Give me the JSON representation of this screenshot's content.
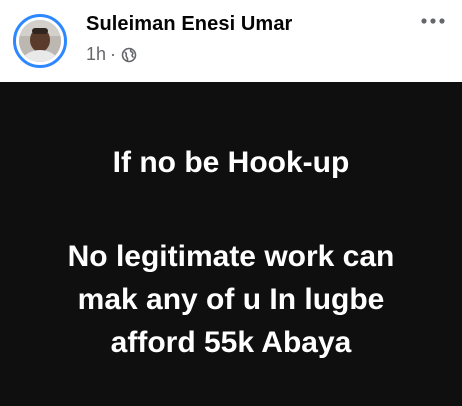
{
  "post": {
    "author": {
      "name": "Suleiman Enesi Umar",
      "avatar_icon": "profile-photo-icon"
    },
    "meta": {
      "timestamp": "1h",
      "separator": "·",
      "audience_icon": "globe-icon",
      "audience": "Public"
    },
    "more_options_icon": "more-horizontal-icon",
    "body": {
      "background_color": "#0f0f0f",
      "text_color": "#ffffff",
      "lines": [
        "If no be Hook-up",
        "No legitimate work can",
        "mak any of u In lugbe",
        "afford 55k Abaya"
      ]
    }
  }
}
